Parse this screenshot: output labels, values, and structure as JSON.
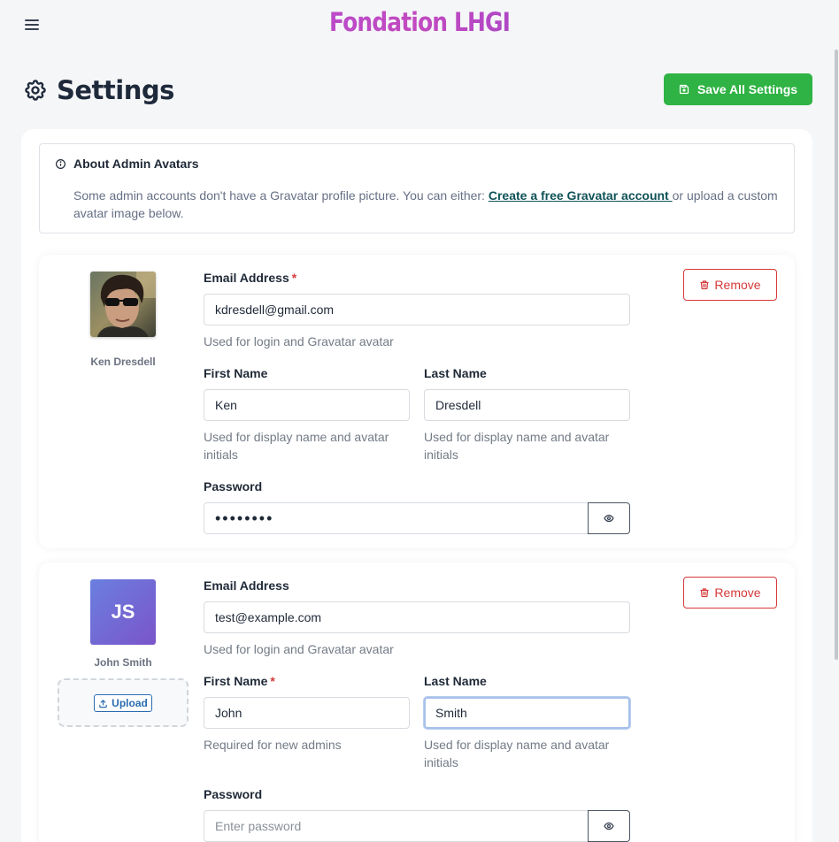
{
  "brand": "Fondation LHGI",
  "page": {
    "title": "Settings",
    "save_label": "Save All Settings"
  },
  "info": {
    "title": "About Admin Avatars",
    "text_before": "Some admin accounts don't have a Gravatar profile picture. You can either: ",
    "link_text": "Create a free Gravatar account ",
    "text_after": "or upload a custom avatar image below."
  },
  "labels": {
    "email": "Email Address",
    "first_name": "First Name",
    "last_name": "Last Name",
    "password": "Password",
    "required_mark": "*",
    "remove": "Remove",
    "upload": "Upload"
  },
  "admins": [
    {
      "display_name": "Ken Dresdell",
      "email": "kdresdell@gmail.com",
      "email_help": "Used for login and Gravatar avatar",
      "first_name": "Ken",
      "first_name_help": "Used for display name and avatar initials",
      "last_name": "Dresdell",
      "last_name_help": "Used for display name and avatar initials",
      "password": "••••••••",
      "avatar_type": "photo"
    },
    {
      "display_name": "John Smith",
      "initials": "JS",
      "email": "test@example.com",
      "email_help": "Used for login and Gravatar avatar",
      "first_name": "John",
      "first_name_help": "Required for new admins",
      "last_name": "Smith",
      "last_name_help": "Used for display name and avatar initials",
      "password": "",
      "password_placeholder": "Enter password",
      "avatar_type": "initials"
    }
  ],
  "colors": {
    "save_button": "#2fb344",
    "danger": "#d63939",
    "link": "#0f5257",
    "avatar_gradient_start": "#6b7fe0",
    "avatar_gradient_end": "#7a55c9"
  }
}
